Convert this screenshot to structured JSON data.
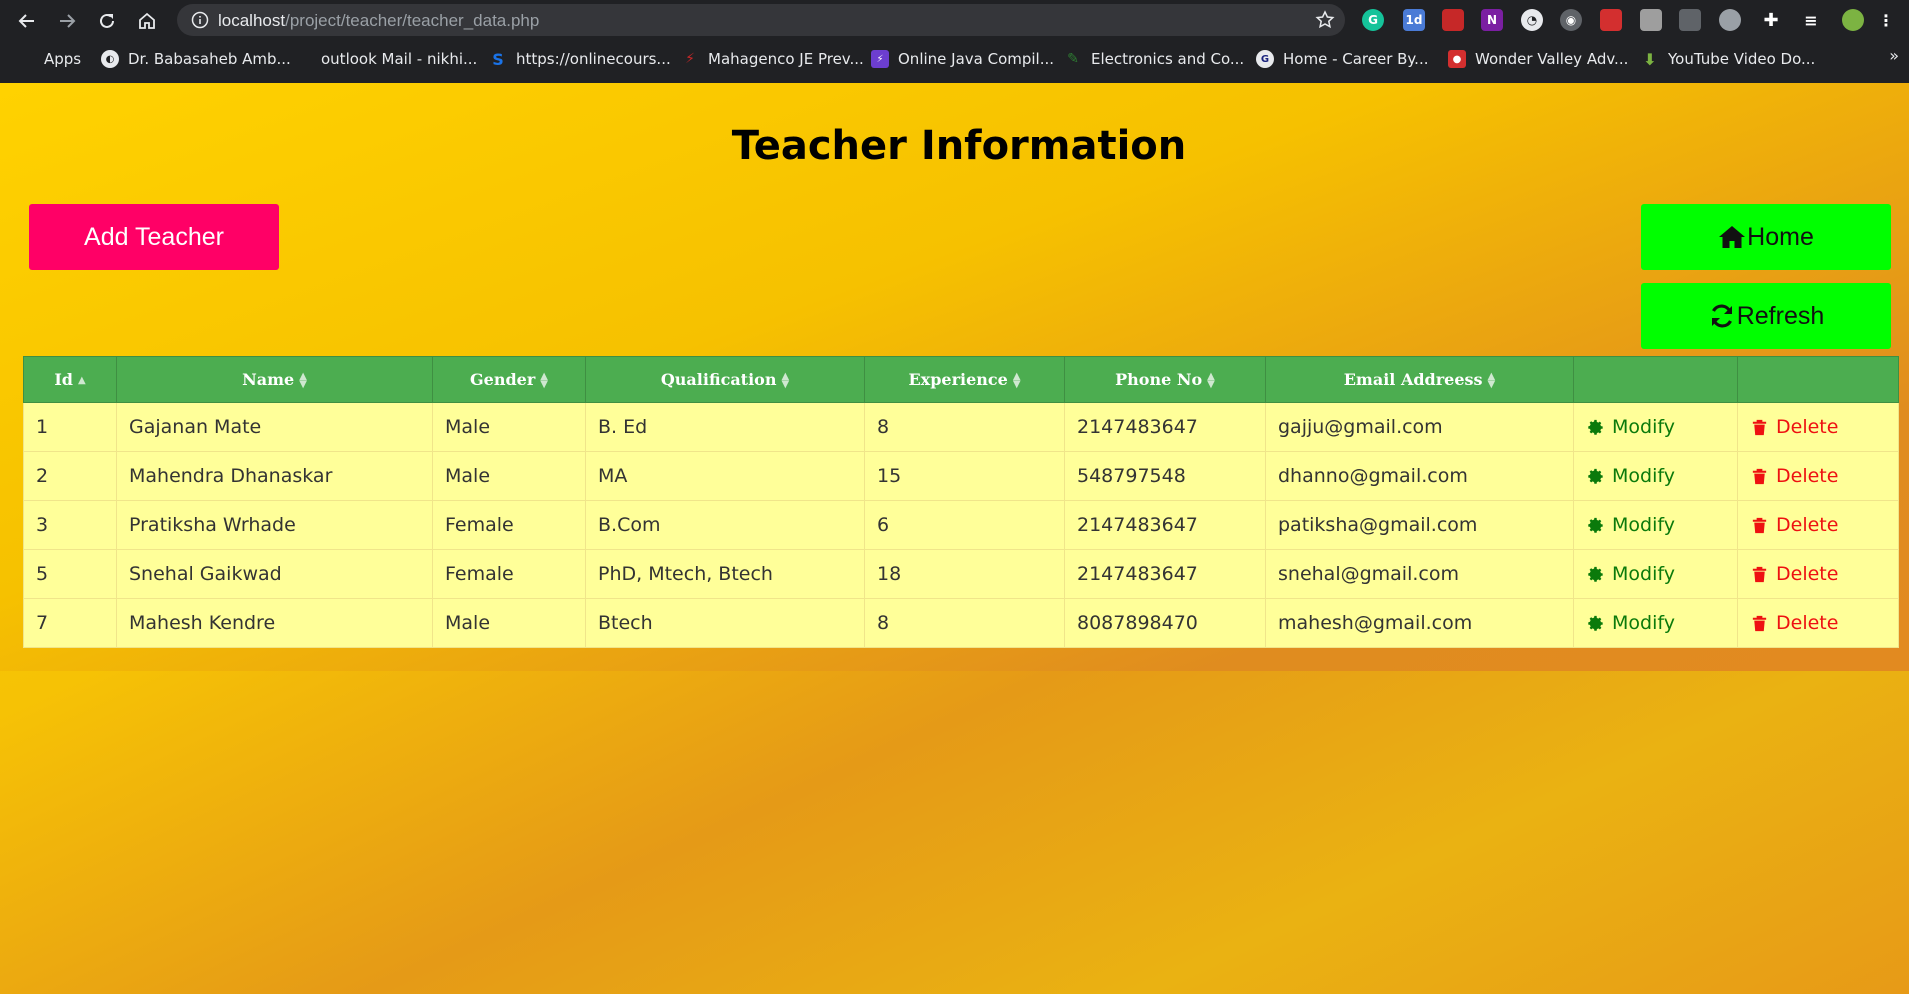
{
  "browser": {
    "url_host": "localhost",
    "url_path": "/project/teacher/teacher_data.php",
    "bookmarks": [
      {
        "label": "Apps",
        "icon": "apps-grid-icon",
        "color": "#e8453c"
      },
      {
        "label": "Dr. Babasaheb Amb...",
        "icon": "globe-icon",
        "color": "#e8eaed"
      },
      {
        "label": "outlook Mail - nikhi...",
        "icon": "microsoft-icon",
        "color": "#f25022"
      },
      {
        "label": "https://onlinecours...",
        "icon": "s-logo-icon",
        "color": "#1a73e8"
      },
      {
        "label": "Mahagenco JE Prev...",
        "icon": "mahagenco-icon",
        "color": "#c62828"
      },
      {
        "label": "Online Java Compil...",
        "icon": "lightning-icon",
        "color": "#6c3ecf"
      },
      {
        "label": "Electronics and Co...",
        "icon": "electronics-icon",
        "color": "#2e7d32"
      },
      {
        "label": "Home - Career By...",
        "icon": "career-icon",
        "color": "#e8eaed"
      },
      {
        "label": "Wonder Valley Adv...",
        "icon": "wonder-valley-icon",
        "color": "#d32f2f"
      },
      {
        "label": "YouTube Video Do...",
        "icon": "download-icon",
        "color": "#7cb342"
      }
    ]
  },
  "page": {
    "title": "Teacher Information",
    "add_button": "Add Teacher",
    "home_button": "Home",
    "refresh_button": "Refresh"
  },
  "table": {
    "headers": [
      "Id",
      "Name",
      "Gender",
      "Qualification",
      "Experience",
      "Phone No",
      "Email Addreess",
      "",
      ""
    ],
    "modify_label": "Modify",
    "delete_label": "Delete",
    "rows": [
      {
        "id": "1",
        "name": "Gajanan Mate",
        "gender": "Male",
        "qualification": "B. Ed",
        "experience": "8",
        "phone": "2147483647",
        "email": "gajju@gmail.com"
      },
      {
        "id": "2",
        "name": "Mahendra Dhanaskar",
        "gender": "Male",
        "qualification": "MA",
        "experience": "15",
        "phone": "548797548",
        "email": "dhanno@gmail.com"
      },
      {
        "id": "3",
        "name": "Pratiksha Wrhade",
        "gender": "Female",
        "qualification": "B.Com",
        "experience": "6",
        "phone": "2147483647",
        "email": "patiksha@gmail.com"
      },
      {
        "id": "5",
        "name": "Snehal Gaikwad",
        "gender": "Female",
        "qualification": "PhD, Mtech, Btech",
        "experience": "18",
        "phone": "2147483647",
        "email": "snehal@gmail.com"
      },
      {
        "id": "7",
        "name": "Mahesh Kendre",
        "gender": "Male",
        "qualification": "Btech",
        "experience": "8",
        "phone": "8087898470",
        "email": "mahesh@gmail.com"
      }
    ]
  },
  "colors": {
    "add_button": "#ff0066",
    "nav_button": "#00ff00",
    "table_header": "#4cad50",
    "table_row": "#ffff99",
    "modify": "#0b7a0b",
    "delete": "#ee1111"
  }
}
